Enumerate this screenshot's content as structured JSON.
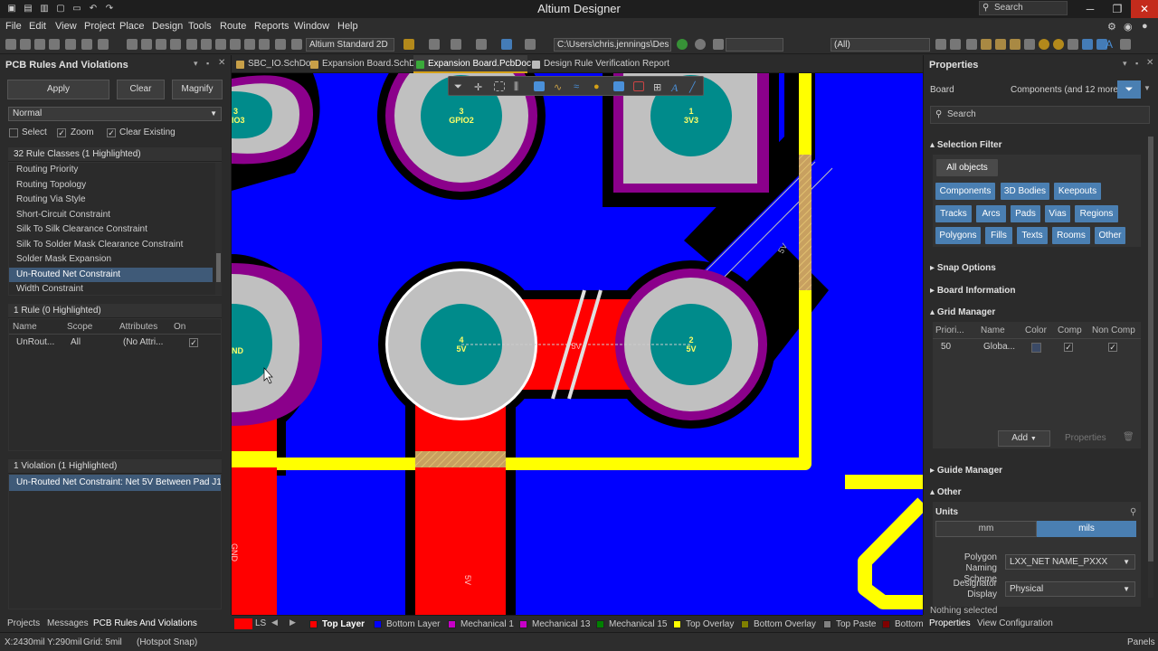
{
  "app": {
    "title": "Altium Designer",
    "search_placeholder": "Search",
    "win_minimize": "─",
    "win_restore": "❐",
    "win_close": "✕"
  },
  "menu": [
    "File",
    "Edit",
    "View",
    "Project",
    "Place",
    "Design",
    "Tools",
    "Route",
    "Reports",
    "Window",
    "Help"
  ],
  "toolbar": {
    "view_config": "Altium Standard 2D",
    "path": "C:\\Users\\chris.jennings\\Des",
    "filter": "(All)"
  },
  "left_panel": {
    "title": "PCB Rules And Violations",
    "apply": "Apply",
    "clear": "Clear",
    "magnify": "Magnify",
    "mode": "Normal",
    "opt_select": "Select",
    "opt_zoom": "Zoom",
    "opt_clear_existing": "Clear Existing",
    "rule_classes_header": "32 Rule Classes (1 Highlighted)",
    "rule_classes": [
      "Routing Priority",
      "Routing Topology",
      "Routing Via Style",
      "Short-Circuit Constraint",
      "Silk To Silk Clearance Constraint",
      "Silk To Solder Mask Clearance Constraint",
      "Solder Mask Expansion",
      "Un-Routed Net Constraint",
      "Width Constraint"
    ],
    "rules_header": "1 Rule (0 Highlighted)",
    "rule_columns": [
      "Name",
      "Scope",
      "Attributes",
      "On"
    ],
    "rule_row": {
      "name": "UnRout...",
      "scope": "All",
      "attributes": "(No Attri...",
      "on": "✓"
    },
    "violations_header": "1 Violation (1 Highlighted)",
    "violation": "Un-Routed Net Constraint: Net 5V Between Pad J1-...",
    "bottom_tabs": [
      "Projects",
      "Messages",
      "PCB Rules And Violations"
    ]
  },
  "doc_tabs": [
    "SBC_IO.SchDoc",
    "Expansion Board.SchDoc",
    "Expansion Board.PcbDoc",
    "Design Rule Verification Report"
  ],
  "canvas": {
    "pad1_num": "1",
    "pad1_net": "3V3",
    "pad3_num": "3",
    "pad3_net": "GPIO2",
    "padL_top": "3",
    "padL_top_net": "IO3",
    "padL_mid_net": "ND",
    "pad4_num": "4",
    "pad4_net": "5V",
    "pad2_num": "2",
    "pad2_net": "5V",
    "trace_label": "5V",
    "bottom_trace_label": "5V",
    "diag_label": "5V",
    "left_label": "GND"
  },
  "layer_bar": {
    "ls": "LS",
    "layers": [
      {
        "name": "Top Layer",
        "color": "#ff0000"
      },
      {
        "name": "Bottom Layer",
        "color": "#0000ff"
      },
      {
        "name": "Mechanical 1",
        "color": "#c800c8"
      },
      {
        "name": "Mechanical 13",
        "color": "#c800c8"
      },
      {
        "name": "Mechanical 15",
        "color": "#008000"
      },
      {
        "name": "Top Overlay",
        "color": "#ffff00"
      },
      {
        "name": "Bottom Overlay",
        "color": "#808000"
      },
      {
        "name": "Top Paste",
        "color": "#808080"
      },
      {
        "name": "Bottom",
        "color": "#800000"
      }
    ]
  },
  "properties": {
    "title": "Properties",
    "board_label": "Board",
    "components_label": "Components (and 12 more)",
    "search_placeholder": "Search",
    "selection_filter": "Selection Filter",
    "all_objects": "All objects",
    "filter_chips": [
      "Components",
      "3D Bodies",
      "Keepouts",
      "Tracks",
      "Arcs",
      "Pads",
      "Vias",
      "Regions",
      "Polygons",
      "Fills",
      "Texts",
      "Rooms",
      "Other"
    ],
    "snap_options": "Snap Options",
    "board_information": "Board Information",
    "grid_manager": "Grid Manager",
    "grid_cols": [
      "Priori...",
      "Name",
      "Color",
      "Comp",
      "Non Comp"
    ],
    "grid_row": {
      "priority": "50",
      "name": "Globa...",
      "comp": "✓",
      "noncomp": "✓"
    },
    "add": "Add",
    "properties_btn": "Properties",
    "guide_manager": "Guide Manager",
    "other": "Other",
    "units": "Units",
    "unit_mm": "mm",
    "unit_mils": "mils",
    "polygon_naming": "Polygon Naming Scheme",
    "polygon_naming_value": "LXX_NET NAME_PXXX",
    "designator_display": "Designator Display",
    "designator_value": "Physical",
    "nothing_selected": "Nothing selected",
    "bottom_tabs": [
      "Properties",
      "View Configuration"
    ]
  },
  "status": {
    "coords": "X:2430mil Y:290mil",
    "grid": "Grid: 5mil",
    "snap": "(Hotspot Snap)",
    "panels": "Panels"
  }
}
